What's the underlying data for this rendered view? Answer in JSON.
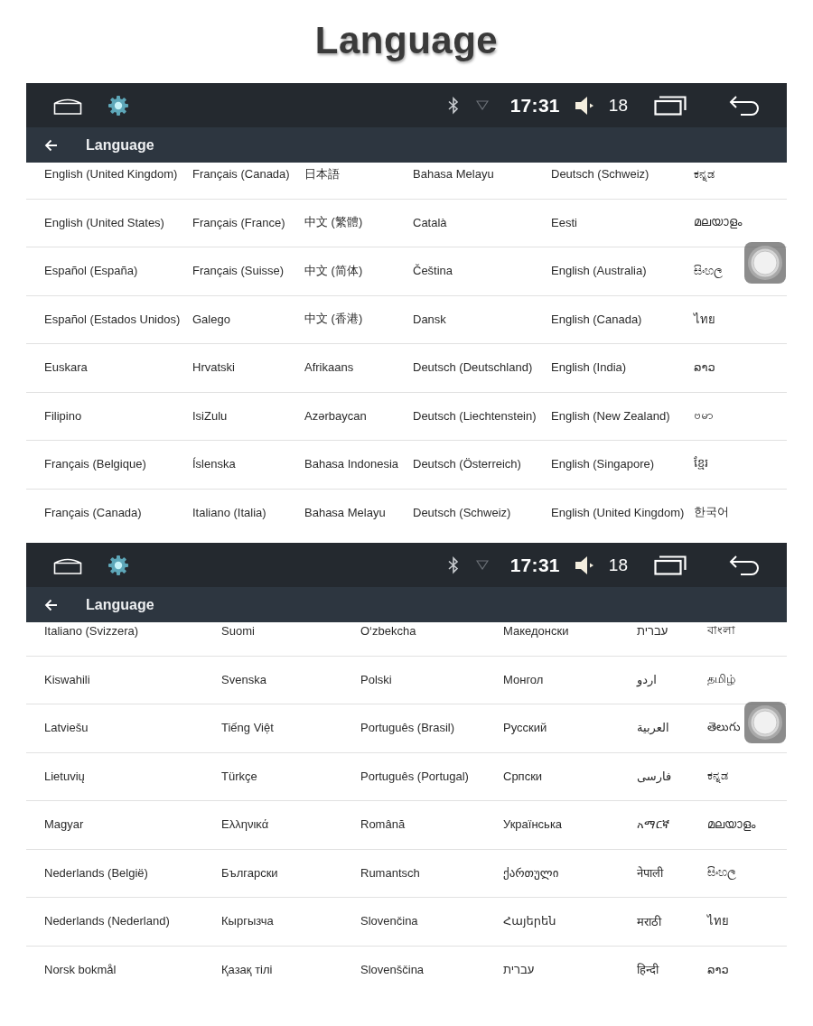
{
  "title": "Language",
  "screens": [
    {
      "status_bar": {
        "time": "17:31",
        "volume": "18"
      },
      "app_bar": {
        "title": "Language"
      },
      "columns": [
        [
          "English (United Kingdom)",
          "English (United States)",
          "Español (España)",
          "Español (Estados Unidos)",
          "Euskara",
          "Filipino",
          "Français (Belgique)",
          "Français (Canada)"
        ],
        [
          "Français (Canada)",
          "Français (France)",
          "Français (Suisse)",
          "Galego",
          "Hrvatski",
          "IsiZulu",
          "Íslenska",
          "Italiano (Italia)"
        ],
        [
          "日本語",
          "中文 (繁體)",
          "中文 (简体)",
          "中文 (香港)",
          "Afrikaans",
          "Azərbaycan",
          "Bahasa Indonesia",
          "Bahasa Melayu"
        ],
        [
          "Bahasa Melayu",
          "Català",
          "Čeština",
          "Dansk",
          "Deutsch (Deutschland)",
          "Deutsch (Liechtenstein)",
          "Deutsch (Österreich)",
          "Deutsch (Schweiz)"
        ],
        [
          "Deutsch (Schweiz)",
          "Eesti",
          "English (Australia)",
          "English (Canada)",
          "English (India)",
          "English (New Zealand)",
          "English (Singapore)",
          "English (United Kingdom)"
        ],
        [
          "ಕನ್ನಡ",
          "മലയാളം",
          "සිංහල",
          "ไทย",
          "ລາວ",
          "ဗမာ",
          "ខ្មែរ",
          "한국어"
        ]
      ]
    },
    {
      "status_bar": {
        "time": "17:31",
        "volume": "18"
      },
      "app_bar": {
        "title": "Language"
      },
      "columns": [
        [
          "Italiano (Svizzera)",
          "Kiswahili",
          "Latviešu",
          "Lietuvių",
          "Magyar",
          "Nederlands (België)",
          "Nederlands (Nederland)",
          "Norsk bokmål"
        ],
        [
          "Suomi",
          "Svenska",
          "Tiếng Việt",
          "Türkçe",
          "Ελληνικά",
          "Български",
          "Кыргызча",
          "Қазақ тілі"
        ],
        [
          "O‘zbekcha",
          "Polski",
          "Português (Brasil)",
          "Português (Portugal)",
          "Română",
          "Rumantsch",
          "Slovenčina",
          "Slovenščina"
        ],
        [
          "Македонски",
          "Монгол",
          "Русский",
          "Српски",
          "Українська",
          "ქართული",
          "Հայերեն",
          "עברית"
        ],
        [
          "עברית",
          "اردو",
          "العربية",
          "فارسی",
          "አማርኛ",
          "नेपाली",
          "मराठी",
          "हिन्दी"
        ],
        [
          "বাংলা",
          "தமிழ்",
          "తెలుగు",
          "ಕನ್ನಡ",
          "മലയാളം",
          "සිංහල",
          "ไทย",
          "ລາວ"
        ]
      ]
    }
  ]
}
